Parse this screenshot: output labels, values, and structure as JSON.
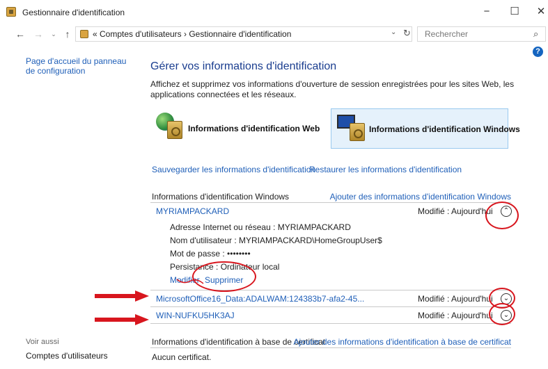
{
  "window": {
    "title": "Gestionnaire d'identification",
    "minimize_glyph": "−",
    "maximize_glyph": "☐",
    "close_glyph": "✕"
  },
  "address": {
    "back_glyph": "←",
    "forward_glyph": "→",
    "recent_glyph": "⌄",
    "up_glyph": "↑",
    "path": "« Comptes d'utilisateurs  ›  Gestionnaire d'identification",
    "dropdown_glyph": "⌄",
    "refresh_glyph": "↻",
    "search_placeholder": "Rechercher",
    "search_glyph": "⌕"
  },
  "help": {
    "glyph": "?"
  },
  "sidebar": {
    "home_link": "Page d'accueil du panneau de configuration",
    "see_also": "Voir aussi",
    "accounts_link": "Comptes d'utilisateurs"
  },
  "main": {
    "title": "Gérer vos informations d'identification",
    "description": "Affichez et supprimez vos informations d'ouverture de session enregistrées pour les sites Web, les applications connectées et les réseaux.",
    "tile_web": "Informations d'identification Web",
    "tile_windows": "Informations d'identification Windows",
    "save_link": "Sauvegarder les informations d'identification",
    "restore_link": "Restaurer les informations d'identification"
  },
  "windows_creds": {
    "header": "Informations d'identification Windows",
    "add_link": "Ajouter des informations d'identification Windows",
    "items": [
      {
        "name": "MYRIAMPACKARD",
        "modified": "Modifié :  Aujourd'hui",
        "chevron": "⌃",
        "details": {
          "address": "Adresse Internet ou réseau :  MYRIAMPACKARD",
          "username": "Nom d'utilisateur :  MYRIAMPACKARD\\HomeGroupUser$",
          "password": "Mot de passe :  ••••••••",
          "persistence": "Persistance :  Ordinateur local"
        },
        "edit": "Modifier",
        "delete": "Supprimer"
      },
      {
        "name": "MicrosoftOffice16_Data:ADALWAM:124383b7-afa2-45...",
        "modified": "Modifié :  Aujourd'hui",
        "chevron": "⌄"
      },
      {
        "name": "WIN-NUFKU5HK3AJ",
        "modified": "Modifié :  Aujourd'hui",
        "chevron": "⌄"
      }
    ]
  },
  "cert_creds": {
    "header": "Informations d'identification à base de certificat",
    "add_link": "Ajouter des informations d'identification à base de certificat",
    "empty": "Aucun certificat."
  },
  "colors": {
    "link": "#1f5fb8",
    "title": "#1a3d8f",
    "selected_tile_bg": "#e5f1fb",
    "annotation_red": "#d8161e"
  }
}
